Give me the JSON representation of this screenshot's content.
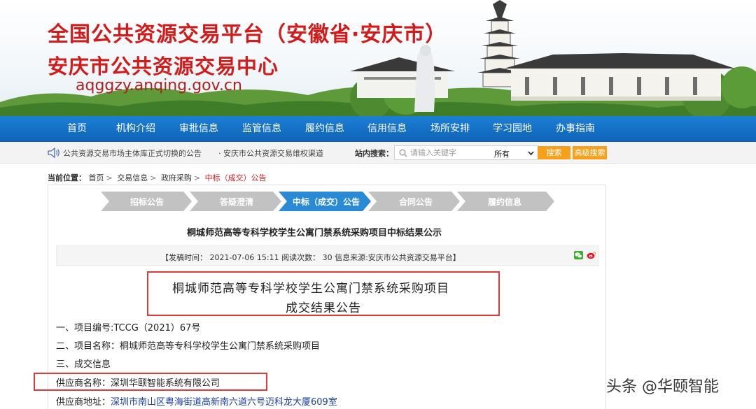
{
  "banner": {
    "title_line1": "全国公共资源交易平台（安徽省·安庆市）",
    "title_line2": "安庆市公共资源交易中心",
    "url": "aqggzy.anqing.gov.cn"
  },
  "nav": {
    "items": [
      "首页",
      "机构介绍",
      "审批信息",
      "监管信息",
      "履约信息",
      "信用信息",
      "场所安排",
      "学习园地",
      "办事指南"
    ]
  },
  "ticker": {
    "items": [
      "公共资源交易市场主体库正式切换的公告",
      "·  安庆市公共资源交易维权渠道"
    ]
  },
  "search": {
    "label": "站内搜索：",
    "placeholder": "请输入关键字",
    "select_value": "所有",
    "search_button": "搜索",
    "advanced_button": "高级搜索"
  },
  "breadcrumb": {
    "label": "当前位置：",
    "items": [
      "首页",
      "交易信息",
      "政府采购"
    ],
    "current": "中标（成交）公告"
  },
  "steps": {
    "items": [
      "招标公告",
      "答疑澄清",
      "中标（成交）公告",
      "合同公告",
      "履约信息"
    ],
    "active_index": 2
  },
  "article": {
    "title": "桐城师范高等专科学校学生公寓门禁系统采购项目中标结果公示",
    "meta": "【发稿时间：  2021-07-06 15:11    阅读次数：  30    信息来源:安庆市公共资源交易平台】",
    "notice_title_line1": "桐城师范高等专科学校学生公寓门禁系统采购项目",
    "notice_title_line2": "成交结果公告",
    "lines": [
      "一、项目编号:TCCG（2021）67号",
      "二、项目名称：桐城师范高等专科学校学生公寓门禁系统采购项目",
      "三、成交信息",
      "供应商名称：深圳华颐智能系统有限公司"
    ],
    "address_label": "供应商地址：",
    "address_value": "深圳市南山区粤海街道高新南六道六号迈科龙大厦609室"
  },
  "watermark": "头条 @华颐智能",
  "colors": {
    "brand_red": "#d21c1c",
    "nav_blue": "#1470c6",
    "step_active": "#2a8ad6",
    "step_inactive": "#bdbdbd",
    "button_orange": "#f7a11b",
    "highlight_red": "#e23a3a"
  },
  "icons": [
    "speaker-icon",
    "search-icon",
    "chevron-down-icon",
    "wechat-icon",
    "weibo-icon"
  ]
}
